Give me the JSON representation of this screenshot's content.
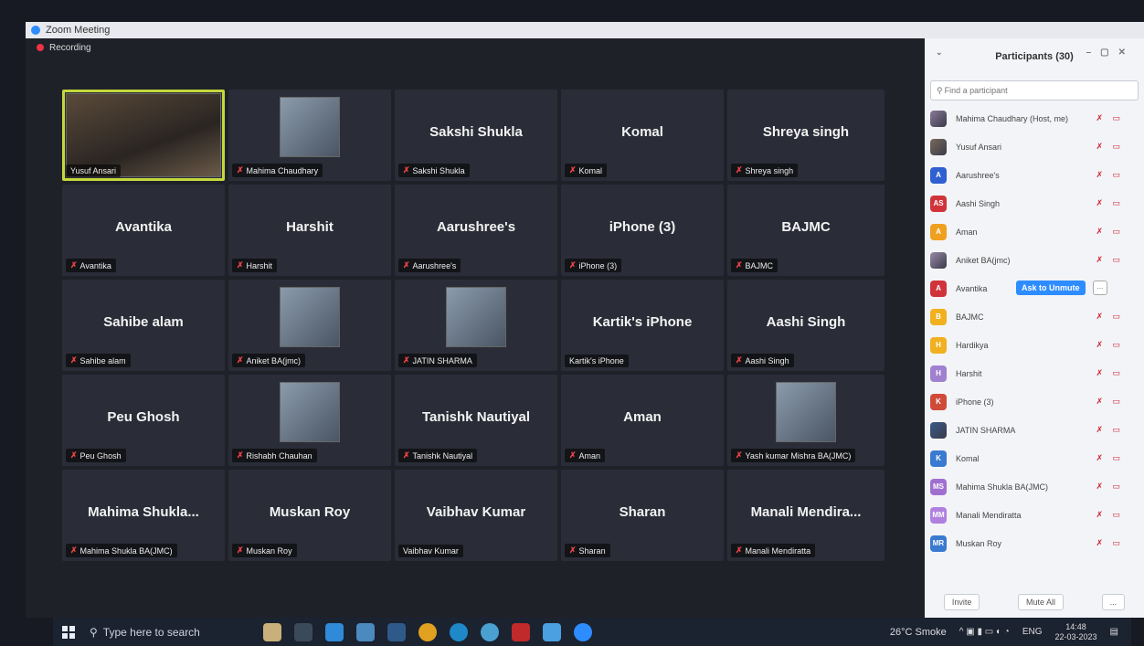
{
  "window": {
    "title": "Zoom Meeting",
    "recording_label": "Recording"
  },
  "tiles": [
    {
      "big": "",
      "label": "Yusuf Ansari",
      "muted": false,
      "type": "video",
      "active": true
    },
    {
      "big": "",
      "label": "Mahima Chaudhary",
      "muted": true,
      "type": "photo"
    },
    {
      "big": "Sakshi Shukla",
      "label": "Sakshi Shukla",
      "muted": true
    },
    {
      "big": "Komal",
      "label": "Komal",
      "muted": true
    },
    {
      "big": "Shreya singh",
      "label": "Shreya singh",
      "muted": true
    },
    {
      "big": "Avantika",
      "label": "Avantika",
      "muted": true
    },
    {
      "big": "Harshit",
      "label": "Harshit",
      "muted": true
    },
    {
      "big": "Aarushree's",
      "label": "Aarushree's",
      "muted": true
    },
    {
      "big": "iPhone (3)",
      "label": "iPhone (3)",
      "muted": true
    },
    {
      "big": "BAJMC",
      "label": "BAJMC",
      "muted": true
    },
    {
      "big": "Sahibe alam",
      "label": "Sahibe alam",
      "muted": true
    },
    {
      "big": "",
      "label": "Aniket BA(jmc)",
      "muted": true,
      "type": "photo"
    },
    {
      "big": "",
      "label": "JATIN SHARMA",
      "muted": true,
      "type": "photo"
    },
    {
      "big": "Kartik's iPhone",
      "label": "Kartik's iPhone",
      "muted": false
    },
    {
      "big": "Aashi Singh",
      "label": "Aashi Singh",
      "muted": true
    },
    {
      "big": "Peu Ghosh",
      "label": "Peu Ghosh",
      "muted": true
    },
    {
      "big": "",
      "label": "Rishabh Chauhan",
      "muted": true,
      "type": "photo"
    },
    {
      "big": "Tanishk Nautiyal",
      "label": "Tanishk Nautiyal",
      "muted": true
    },
    {
      "big": "Aman",
      "label": "Aman",
      "muted": true
    },
    {
      "big": "",
      "label": "Yash kumar Mishra BA(JMC)",
      "muted": true,
      "type": "photo"
    },
    {
      "big": "Mahima Shukla...",
      "label": "Mahima Shukla BA(JMC)",
      "muted": true
    },
    {
      "big": "Muskan Roy",
      "label": "Muskan Roy",
      "muted": true
    },
    {
      "big": "Vaibhav Kumar",
      "label": "Vaibhav Kumar",
      "muted": false
    },
    {
      "big": "Sharan",
      "label": "Sharan",
      "muted": true
    },
    {
      "big": "Manali Mendira...",
      "label": "Manali Mendiratta",
      "muted": true
    }
  ],
  "participants": {
    "header": "Participants (30)",
    "search_placeholder": "Find a participant",
    "list": [
      {
        "initials": "",
        "name": "Mahima Chaudhary (Host, me)",
        "color": "#8a7a9a",
        "photo": true
      },
      {
        "initials": "",
        "name": "Yusuf Ansari",
        "color": "#7a6a5a",
        "photo": true
      },
      {
        "initials": "A",
        "name": "Aarushree's",
        "color": "#2f5fd0"
      },
      {
        "initials": "AS",
        "name": "Aashi Singh",
        "color": "#d0343a"
      },
      {
        "initials": "A",
        "name": "Aman",
        "color": "#f0a020"
      },
      {
        "initials": "",
        "name": "Aniket BA(jmc)",
        "color": "#9a8aa8",
        "photo": true
      },
      {
        "initials": "A",
        "name": "Avantika",
        "color": "#d0343a",
        "hover": true
      },
      {
        "initials": "B",
        "name": "BAJMC",
        "color": "#f0b020"
      },
      {
        "initials": "H",
        "name": "Hardikya",
        "color": "#f0b020"
      },
      {
        "initials": "H",
        "name": "Harshit",
        "color": "#a080d0"
      },
      {
        "initials": "K",
        "name": "iPhone (3)",
        "color": "#d04a3a"
      },
      {
        "initials": "",
        "name": "JATIN SHARMA",
        "color": "#3a5a8a",
        "photo": true
      },
      {
        "initials": "K",
        "name": "Komal",
        "color": "#3a7ad0"
      },
      {
        "initials": "MS",
        "name": "Mahima Shukla BA(JMC)",
        "color": "#a070d0"
      },
      {
        "initials": "MM",
        "name": "Manali Mendiratta",
        "color": "#b080e0"
      },
      {
        "initials": "MR",
        "name": "Muskan Roy",
        "color": "#3a7ad0"
      }
    ],
    "ask_to_unmute": "Ask to Unmute",
    "more": "...",
    "invite": "Invite",
    "mute_all": "Mute All"
  },
  "taskbar": {
    "search_placeholder": "Type here to search",
    "weather": "26°C Smoke",
    "lang": "ENG",
    "time": "14:48",
    "date": "22-03-2023"
  }
}
